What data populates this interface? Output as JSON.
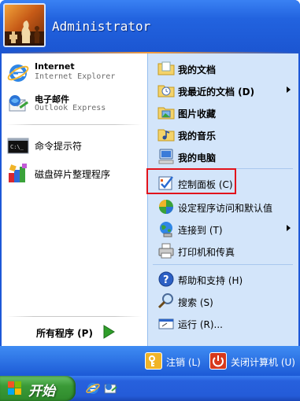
{
  "user": {
    "name": "Administrator"
  },
  "pinned": [
    {
      "title": "Internet",
      "subtitle": "Internet Explorer",
      "icon": "internet-explorer-icon"
    },
    {
      "title": "电子邮件",
      "subtitle": "Outlook Express",
      "icon": "outlook-express-icon"
    }
  ],
  "recent": [
    {
      "label": "命令提示符",
      "icon": "command-prompt-icon"
    },
    {
      "label": "磁盘碎片整理程序",
      "icon": "disk-defragmenter-icon"
    }
  ],
  "all_programs": {
    "label": "所有程序 (P)",
    "icon": "green-arrow-icon"
  },
  "places": [
    {
      "label": "我的文档",
      "icon": "my-documents-icon"
    },
    {
      "label": "我最近的文档 (D)",
      "icon": "recent-documents-icon",
      "submenu": true
    },
    {
      "label": "图片收藏",
      "icon": "my-pictures-icon"
    },
    {
      "label": "我的音乐",
      "icon": "my-music-icon"
    },
    {
      "label": "我的电脑",
      "icon": "my-computer-icon"
    },
    {
      "label": "控制面板 (C)",
      "icon": "control-panel-icon",
      "highlighted": true
    },
    {
      "label": "设定程序访问和默认值",
      "icon": "program-access-icon"
    },
    {
      "label": "连接到 (T)",
      "icon": "connect-to-icon",
      "submenu": true
    },
    {
      "label": "打印机和传真",
      "icon": "printers-faxes-icon"
    },
    {
      "label": "帮助和支持 (H)",
      "icon": "help-icon"
    },
    {
      "label": "搜索 (S)",
      "icon": "search-icon"
    },
    {
      "label": "运行 (R)...",
      "icon": "run-icon"
    }
  ],
  "footer": {
    "logoff": {
      "label": "注销 (L)",
      "icon": "log-off-icon"
    },
    "shutdown": {
      "label": "关闭计算机 (U)",
      "icon": "shut-down-icon"
    }
  },
  "taskbar": {
    "start_label": "开始",
    "quick_launch": [
      "internet-explorer-icon",
      "outlook-express-icon"
    ]
  },
  "colors": {
    "menu_blue": "#1d58d7",
    "places_bg": "#d3e5fa",
    "highlight_box": "#e2131b",
    "start_green": "#3a9a37"
  }
}
